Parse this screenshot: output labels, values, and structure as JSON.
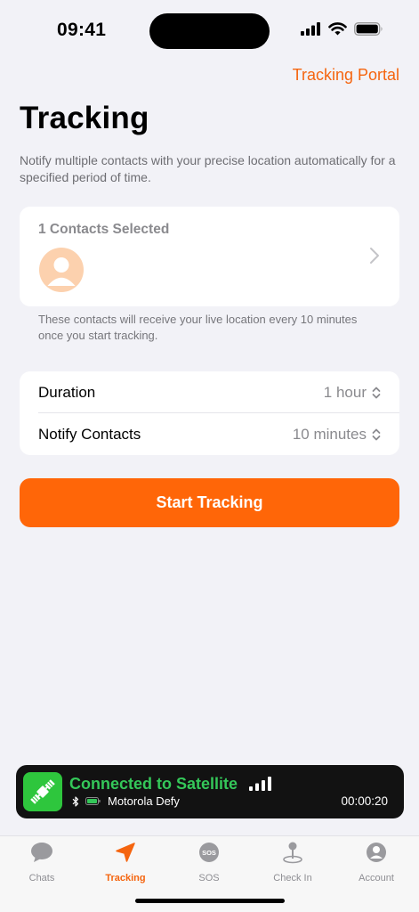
{
  "status_bar": {
    "time": "09:41"
  },
  "header": {
    "portal_link": "Tracking Portal",
    "title": "Tracking"
  },
  "description": "Notify multiple contacts with your precise location automatically for a specified period of time.",
  "contacts": {
    "title": "1 Contacts Selected",
    "note": "These contacts will receive your live location every 10 minutes once you start tracking."
  },
  "settings": {
    "duration": {
      "label": "Duration",
      "value": "1 hour"
    },
    "notify": {
      "label": "Notify Contacts",
      "value": "10 minutes"
    }
  },
  "start_button": "Start Tracking",
  "satellite": {
    "status": "Connected to Satellite",
    "device": "Motorola Defy",
    "timer": "00:00:20"
  },
  "tabs": [
    {
      "label": "Chats",
      "icon": "chat-bubble-icon"
    },
    {
      "label": "Tracking",
      "icon": "location-arrow-icon",
      "active": true
    },
    {
      "label": "SOS",
      "icon": "sos-icon"
    },
    {
      "label": "Check In",
      "icon": "map-pin-icon"
    },
    {
      "label": "Account",
      "icon": "person-icon"
    }
  ],
  "colors": {
    "accent": "#ff6608",
    "background": "#f2f2f7",
    "satellite_green": "#34c759",
    "avatar_bg": "#fcd1ae"
  }
}
